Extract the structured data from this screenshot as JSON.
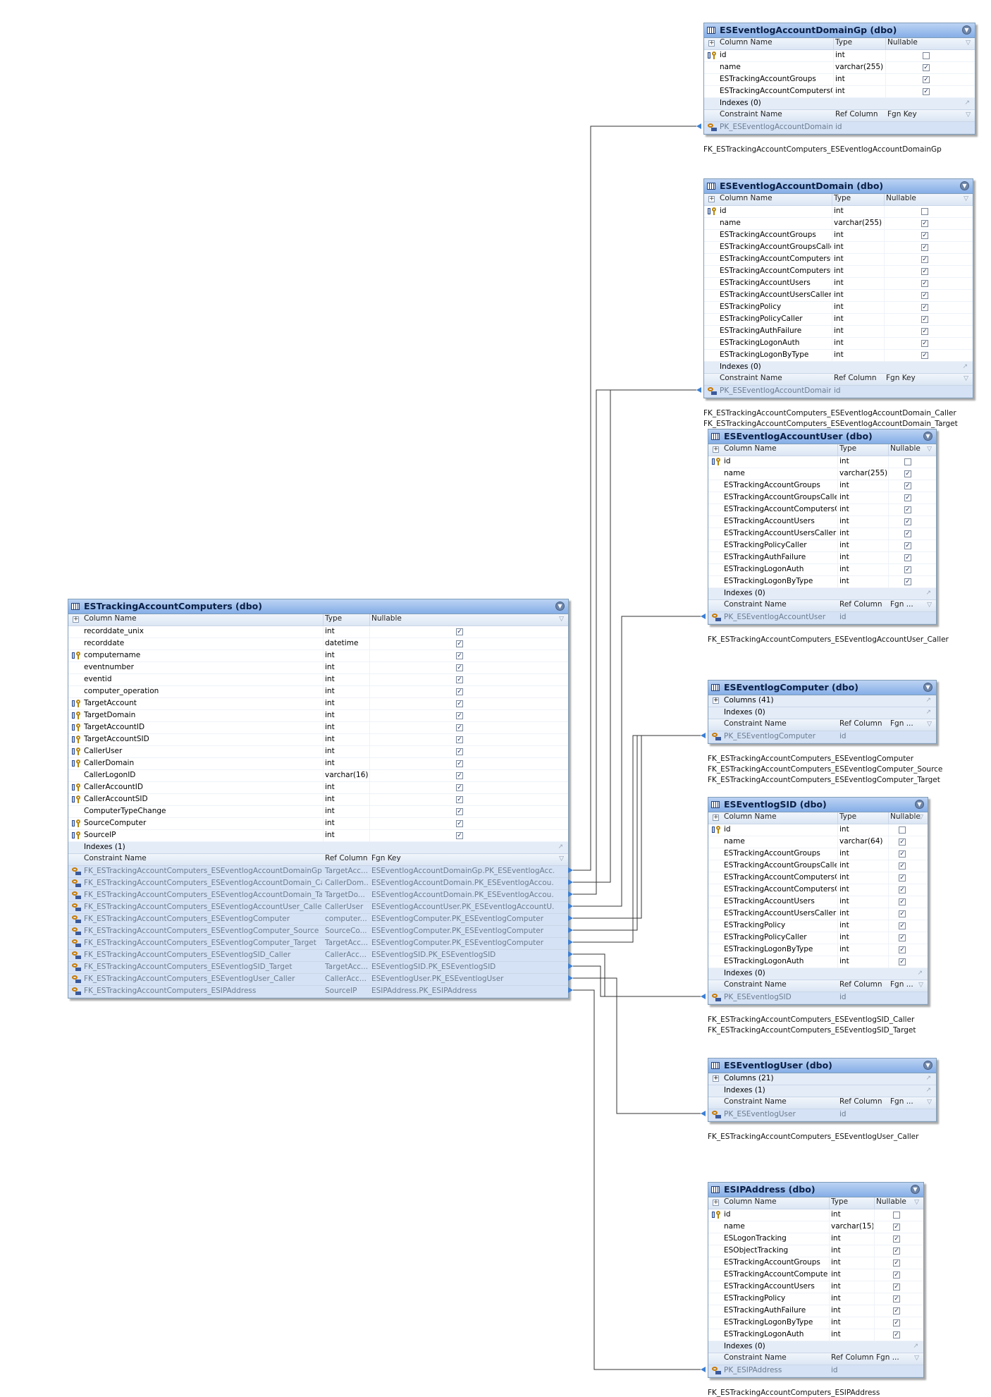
{
  "headers": {
    "column": "Column Name",
    "type": "Type",
    "nullable": "Nullable",
    "constraint": "Constraint Name",
    "ref": "Ref Column",
    "fgn": "Fgn Key",
    "fgn_short": "Fgn ..."
  },
  "tables": [
    {
      "id": "domaingp",
      "title": "ESEventlogAccountDomainGp (dbo)",
      "columns": [
        {
          "name": "id",
          "type": "int",
          "nullable": false,
          "key": true
        },
        {
          "name": "name",
          "type": "varchar(255)",
          "nullable": true
        },
        {
          "name": "ESTrackingAccountGroups",
          "type": "int",
          "nullable": true
        },
        {
          "name": "ESTrackingAccountComputersCli",
          "type": "int",
          "nullable": true
        }
      ],
      "indexes": "Indexes (0)",
      "constraints": [
        {
          "name": "PK_ESEventlogAccountDomainGp",
          "ref": "id",
          "fgn": ""
        }
      ],
      "fk_names": [
        "FK_ESTrackingAccountComputers_ESEventlogAccountDomainGp"
      ]
    },
    {
      "id": "domain",
      "title": "ESEventlogAccountDomain (dbo)",
      "columns": [
        {
          "name": "id",
          "type": "int",
          "nullable": false,
          "key": true
        },
        {
          "name": "name",
          "type": "varchar(255)",
          "nullable": true
        },
        {
          "name": "ESTrackingAccountGroups",
          "type": "int",
          "nullable": true
        },
        {
          "name": "ESTrackingAccountGroupsCaller",
          "type": "int",
          "nullable": true
        },
        {
          "name": "ESTrackingAccountComputersCli",
          "type": "int",
          "nullable": true
        },
        {
          "name": "ESTrackingAccountComputersClr",
          "type": "int",
          "nullable": true
        },
        {
          "name": "ESTrackingAccountUsers",
          "type": "int",
          "nullable": true
        },
        {
          "name": "ESTrackingAccountUsersCaller",
          "type": "int",
          "nullable": true
        },
        {
          "name": "ESTrackingPolicy",
          "type": "int",
          "nullable": true
        },
        {
          "name": "ESTrackingPolicyCaller",
          "type": "int",
          "nullable": true
        },
        {
          "name": "ESTrackingAuthFailure",
          "type": "int",
          "nullable": true
        },
        {
          "name": "ESTrackingLogonAuth",
          "type": "int",
          "nullable": true
        },
        {
          "name": "ESTrackingLogonByType",
          "type": "int",
          "nullable": true
        }
      ],
      "indexes": "Indexes (0)",
      "constraints": [
        {
          "name": "PK_ESEventlogAccountDomain",
          "ref": "id",
          "fgn": ""
        }
      ],
      "fk_names": [
        "FK_ESTrackingAccountComputers_ESEventlogAccountDomain_Caller",
        "FK_ESTrackingAccountComputers_ESEventlogAccountDomain_Target"
      ]
    },
    {
      "id": "accountuser",
      "title": "ESEventlogAccountUser (dbo)",
      "columns": [
        {
          "name": "id",
          "type": "int",
          "nullable": false,
          "key": true
        },
        {
          "name": "name",
          "type": "varchar(255)",
          "nullable": true
        },
        {
          "name": "ESTrackingAccountGroups",
          "type": "int",
          "nullable": true
        },
        {
          "name": "ESTrackingAccountGroupsCaller",
          "type": "int",
          "nullable": true
        },
        {
          "name": "ESTrackingAccountComputersClr",
          "type": "int",
          "nullable": true
        },
        {
          "name": "ESTrackingAccountUsers",
          "type": "int",
          "nullable": true
        },
        {
          "name": "ESTrackingAccountUsersCaller",
          "type": "int",
          "nullable": true
        },
        {
          "name": "ESTrackingPolicyCaller",
          "type": "int",
          "nullable": true
        },
        {
          "name": "ESTrackingAuthFailure",
          "type": "int",
          "nullable": true
        },
        {
          "name": "ESTrackingLogonAuth",
          "type": "int",
          "nullable": true
        },
        {
          "name": "ESTrackingLogonByType",
          "type": "int",
          "nullable": true
        }
      ],
      "indexes": "Indexes (0)",
      "constraints": [
        {
          "name": "PK_ESEventlogAccountUser",
          "ref": "id",
          "fgn": ""
        }
      ],
      "fk_names": [
        "FK_ESTrackingAccountComputers_ESEventlogAccountUser_Caller"
      ]
    },
    {
      "id": "computer",
      "title": "ESEventlogComputer (dbo)",
      "collapsed_columns": "Columns (41)",
      "indexes": "Indexes (0)",
      "constraints": [
        {
          "name": "PK_ESEventlogComputer",
          "ref": "id",
          "fgn": ""
        }
      ],
      "fk_names": [
        "FK_ESTrackingAccountComputers_ESEventlogComputer",
        "FK_ESTrackingAccountComputers_ESEventlogComputer_Source",
        "FK_ESTrackingAccountComputers_ESEventlogComputer_Target"
      ]
    },
    {
      "id": "sid",
      "title": "ESEventlogSID (dbo)",
      "columns": [
        {
          "name": "id",
          "type": "int",
          "nullable": false,
          "key": true
        },
        {
          "name": "name",
          "type": "varchar(64)",
          "nullable": true
        },
        {
          "name": "ESTrackingAccountGroups",
          "type": "int",
          "nullable": true
        },
        {
          "name": "ESTrackingAccountGroupsCaller",
          "type": "int",
          "nullable": true
        },
        {
          "name": "ESTrackingAccountComputersCli",
          "type": "int",
          "nullable": true
        },
        {
          "name": "ESTrackingAccountComputersClr",
          "type": "int",
          "nullable": true
        },
        {
          "name": "ESTrackingAccountUsers",
          "type": "int",
          "nullable": true
        },
        {
          "name": "ESTrackingAccountUsersCaller",
          "type": "int",
          "nullable": true
        },
        {
          "name": "ESTrackingPolicy",
          "type": "int",
          "nullable": true
        },
        {
          "name": "ESTrackingPolicyCaller",
          "type": "int",
          "nullable": true
        },
        {
          "name": "ESTrackingLogonByType",
          "type": "int",
          "nullable": true
        },
        {
          "name": "ESTrackingLogonAuth",
          "type": "int",
          "nullable": true
        }
      ],
      "indexes": "Indexes (0)",
      "constraints": [
        {
          "name": "PK_ESEventlogSID",
          "ref": "id",
          "fgn": ""
        }
      ],
      "fk_names": [
        "FK_ESTrackingAccountComputers_ESEventlogSID_Caller",
        "FK_ESTrackingAccountComputers_ESEventlogSID_Target"
      ]
    },
    {
      "id": "eventloguser",
      "title": "ESEventlogUser (dbo)",
      "collapsed_columns": "Columns (21)",
      "indexes": "Indexes (1)",
      "constraints": [
        {
          "name": "PK_ESEventlogUser",
          "ref": "id",
          "fgn": ""
        }
      ],
      "fk_names": [
        "FK_ESTrackingAccountComputers_ESEventlogUser_Caller"
      ]
    },
    {
      "id": "ipaddress",
      "title": "ESIPAddress (dbo)",
      "columns": [
        {
          "name": "id",
          "type": "int",
          "nullable": false,
          "key": true
        },
        {
          "name": "name",
          "type": "varchar(15)",
          "nullable": true
        },
        {
          "name": "ESLogonTracking",
          "type": "int",
          "nullable": true
        },
        {
          "name": "ESObjectTracking",
          "type": "int",
          "nullable": true
        },
        {
          "name": "ESTrackingAccountGroups",
          "type": "int",
          "nullable": true
        },
        {
          "name": "ESTrackingAccountComputers",
          "type": "int",
          "nullable": true
        },
        {
          "name": "ESTrackingAccountUsers",
          "type": "int",
          "nullable": true
        },
        {
          "name": "ESTrackingPolicy",
          "type": "int",
          "nullable": true
        },
        {
          "name": "ESTrackingAuthFailure",
          "type": "int",
          "nullable": true
        },
        {
          "name": "ESTrackingLogonByType",
          "type": "int",
          "nullable": true
        },
        {
          "name": "ESTrackingLogonAuth",
          "type": "int",
          "nullable": true
        }
      ],
      "indexes": "Indexes (0)",
      "constraints": [
        {
          "name": "PK_ESIPAddress",
          "ref": "id",
          "fgn": ""
        }
      ],
      "fk_names": [
        "FK_ESTrackingAccountComputers_ESIPAddress"
      ]
    },
    {
      "id": "main",
      "title": "ESTrackingAccountComputers (dbo)",
      "columns": [
        {
          "name": "recorddate_unix",
          "type": "int",
          "nullable": true
        },
        {
          "name": "recorddate",
          "type": "datetime",
          "nullable": true
        },
        {
          "name": "computername",
          "type": "int",
          "nullable": true,
          "key": true
        },
        {
          "name": "eventnumber",
          "type": "int",
          "nullable": true
        },
        {
          "name": "eventid",
          "type": "int",
          "nullable": true
        },
        {
          "name": "computer_operation",
          "type": "int",
          "nullable": true
        },
        {
          "name": "TargetAccount",
          "type": "int",
          "nullable": true,
          "key": true
        },
        {
          "name": "TargetDomain",
          "type": "int",
          "nullable": true,
          "key": true
        },
        {
          "name": "TargetAccountID",
          "type": "int",
          "nullable": true,
          "key": true
        },
        {
          "name": "TargetAccountSID",
          "type": "int",
          "nullable": true,
          "key": true
        },
        {
          "name": "CallerUser",
          "type": "int",
          "nullable": true,
          "key": true
        },
        {
          "name": "CallerDomain",
          "type": "int",
          "nullable": true,
          "key": true
        },
        {
          "name": "CallerLogonID",
          "type": "varchar(16)",
          "nullable": true
        },
        {
          "name": "CallerAccountID",
          "type": "int",
          "nullable": true,
          "key": true
        },
        {
          "name": "CallerAccountSID",
          "type": "int",
          "nullable": true,
          "key": true
        },
        {
          "name": "ComputerTypeChange",
          "type": "int",
          "nullable": true
        },
        {
          "name": "SourceComputer",
          "type": "int",
          "nullable": true,
          "key": true
        },
        {
          "name": "SourceIP",
          "type": "int",
          "nullable": true,
          "key": true
        }
      ],
      "indexes": "Indexes (1)",
      "constraints": [
        {
          "name": "FK_ESTrackingAccountComputers_ESEventlogAccountDomainGp",
          "ref": "TargetAcc...",
          "fgn": "ESEventlogAccountDomainGp.PK_ESEventlogAcc..."
        },
        {
          "name": "FK_ESTrackingAccountComputers_ESEventlogAccountDomain_Caller",
          "ref": "CallerDom...",
          "fgn": "ESEventlogAccountDomain.PK_ESEventlogAccou..."
        },
        {
          "name": "FK_ESTrackingAccountComputers_ESEventlogAccountDomain_Target",
          "ref": "TargetDo...",
          "fgn": "ESEventlogAccountDomain.PK_ESEventlogAccou..."
        },
        {
          "name": "FK_ESTrackingAccountComputers_ESEventlogAccountUser_Caller",
          "ref": "CallerUser",
          "fgn": "ESEventlogAccountUser.PK_ESEventlogAccountU..."
        },
        {
          "name": "FK_ESTrackingAccountComputers_ESEventlogComputer",
          "ref": "computer...",
          "fgn": "ESEventlogComputer.PK_ESEventlogComputer"
        },
        {
          "name": "FK_ESTrackingAccountComputers_ESEventlogComputer_Source",
          "ref": "SourceCo...",
          "fgn": "ESEventlogComputer.PK_ESEventlogComputer"
        },
        {
          "name": "FK_ESTrackingAccountComputers_ESEventlogComputer_Target",
          "ref": "TargetAcc...",
          "fgn": "ESEventlogComputer.PK_ESEventlogComputer"
        },
        {
          "name": "FK_ESTrackingAccountComputers_ESEventlogSID_Caller",
          "ref": "CallerAcc...",
          "fgn": "ESEventlogSID.PK_ESEventlogSID"
        },
        {
          "name": "FK_ESTrackingAccountComputers_ESEventlogSID_Target",
          "ref": "TargetAcc...",
          "fgn": "ESEventlogSID.PK_ESEventlogSID"
        },
        {
          "name": "FK_ESTrackingAccountComputers_ESEventlogUser_Caller",
          "ref": "CallerAcc...",
          "fgn": "ESEventlogUser.PK_ESEventlogUser"
        },
        {
          "name": "FK_ESTrackingAccountComputers_ESIPAddress",
          "ref": "SourceIP",
          "fgn": "ESIPAddress.PK_ESIPAddress"
        }
      ]
    }
  ],
  "relationships": [
    {
      "from_row": 0,
      "to": "domaingp"
    },
    {
      "from_row": 1,
      "to": "domain"
    },
    {
      "from_row": 2,
      "to": "domain"
    },
    {
      "from_row": 3,
      "to": "accountuser"
    },
    {
      "from_row": 4,
      "to": "computer"
    },
    {
      "from_row": 5,
      "to": "computer"
    },
    {
      "from_row": 6,
      "to": "computer"
    },
    {
      "from_row": 7,
      "to": "sid"
    },
    {
      "from_row": 8,
      "to": "sid"
    },
    {
      "from_row": 9,
      "to": "eventloguser"
    },
    {
      "from_row": 10,
      "to": "ipaddress"
    }
  ],
  "colors": {
    "title_top": "#bcd3f3",
    "title_bottom": "#85aee7",
    "body": "#d7e5f8",
    "line": "#333333",
    "arrow": "#3b7fd4"
  }
}
